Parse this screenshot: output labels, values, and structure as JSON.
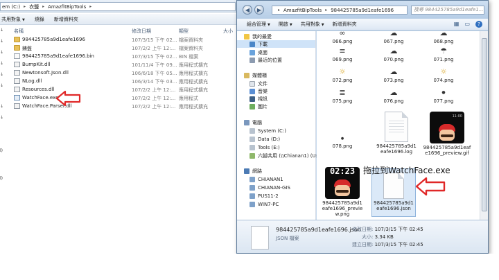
{
  "back_window": {
    "address": {
      "prefix": "em (C:)",
      "parts": [
        "衣鹽",
        "AmazfitBipTools"
      ]
    },
    "toolbar": {
      "organize": "共用對象",
      "burn": "燒錄",
      "new_folder": "新增資料夾"
    },
    "columns": {
      "name": "名稱",
      "date": "修改日期",
      "type": "類型",
      "size": "大小"
    },
    "files": [
      {
        "name": "984425785a9d1eafe1696",
        "date": "107/3/15 下午 02...",
        "type": "檔案資料夾",
        "kind": "folder"
      },
      {
        "name": "錶盤",
        "date": "107/2/2 上午 12:...",
        "type": "檔案資料夾",
        "kind": "folder"
      },
      {
        "name": "984425785a9d1eafe1696.bin",
        "date": "107/3/15 下午 02...",
        "type": "BIN 檔案",
        "kind": "file"
      },
      {
        "name": "BumpKit.dll",
        "date": "101/11/4 下午 09...",
        "type": "應用程式擴充",
        "kind": "dll"
      },
      {
        "name": "Newtonsoft.Json.dll",
        "date": "106/6/18 下午 05...",
        "type": "應用程式擴充",
        "kind": "dll"
      },
      {
        "name": "NLog.dll",
        "date": "106/3/14 下午 03...",
        "type": "應用程式擴充",
        "kind": "dll"
      },
      {
        "name": "Resources.dll",
        "date": "107/2/2 上午 12:...",
        "type": "應用程式擴充",
        "kind": "dll"
      },
      {
        "name": "WatchFace.exe",
        "date": "107/2/2 上午 12:...",
        "type": "應用程式",
        "kind": "exe"
      },
      {
        "name": "WatchFace.Parser.dll",
        "date": "107/2/2 上午 12:...",
        "type": "應用程式擴充",
        "kind": "dll"
      }
    ],
    "left_edge_chars": [
      "↓",
      "↓",
      "↓",
      "↓",
      "↓",
      "↓",
      "↓",
      "↓",
      "l)",
      "l)"
    ]
  },
  "front_window": {
    "address": {
      "parts": [
        "AmazfitBipTools",
        "984425785a9d1eafe1696"
      ]
    },
    "search_placeholder": "搜尋 984425785a9d1eafe1...",
    "toolbar": {
      "organize": "組合管理",
      "open": "開啟",
      "share": "共用對象",
      "new_folder": "新增資料夾"
    },
    "nav": {
      "favorites": "我的最愛",
      "downloads": "下載",
      "desktop": "桌面",
      "recent": "最近的位置",
      "libraries": "媒體櫃",
      "documents": "文件",
      "music": "音樂",
      "videos": "視訊",
      "pictures": "圖片",
      "computer": "電腦",
      "drive_c": "System (C:)",
      "drive_d": "Data (D:)",
      "drive_e": "Tools (E:)",
      "drive_u": "六腳共用 (\\\\Chianan1) (U:)",
      "network": "網路",
      "net1": "CHIANAN1",
      "net2": "CHIANAN-GIS",
      "net3": "PUS11-2",
      "net4": "WIN7-PC"
    },
    "grid_names": {
      "r1": [
        "066.png",
        "067.png",
        "068.png"
      ],
      "r2": [
        "069.png",
        "070.png",
        "071.png"
      ],
      "r3": [
        "072.png",
        "073.png",
        "074.png"
      ],
      "r4": [
        "075.png",
        "076.png",
        "077.png"
      ],
      "f078": "078.png",
      "flog": "984425785a9d1eafe1696.log",
      "fgif": "984425785a9d1eafe1696_preview.gif",
      "fpng": "984425785a9d1eafe1696_preview.png",
      "fjson": "984425785a9d1eafe1696.json"
    },
    "preview_time": "02:23",
    "preview_small": "11:00",
    "details": {
      "name": "984425785a9d1eafe1696.json",
      "type": "JSON 檔案",
      "modified_label": "修改日期:",
      "modified": "107/3/15 下午 02:45",
      "size_label": "大小:",
      "size": "3.34 KB",
      "created_label": "建立日期:",
      "created": "107/3/15 下午 02:45"
    }
  },
  "annotation": {
    "drag_to": "拖拉到WatchFace.exe"
  },
  "colors": {
    "arrow": "#e02828",
    "selection": "#dbe9f8"
  }
}
